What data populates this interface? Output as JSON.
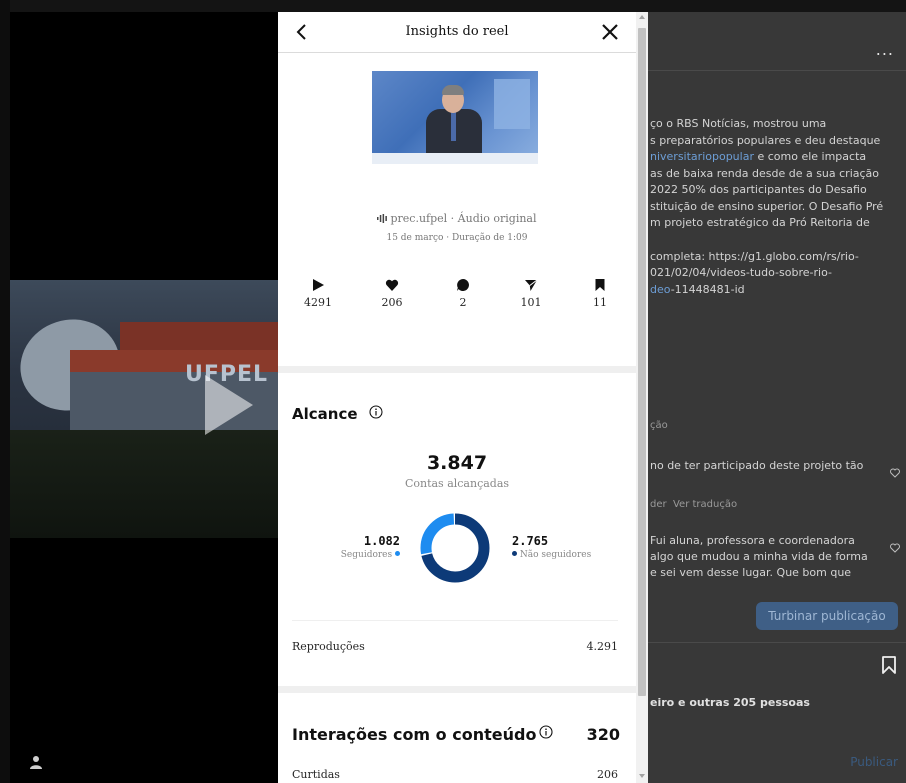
{
  "modal": {
    "title": "Insights do reel",
    "audio": "prec.ufpel · Áudio original",
    "date_duration": "15 de março · Duração de 1:09",
    "stats": [
      {
        "icon": "play-icon",
        "value": "4291"
      },
      {
        "icon": "heart-icon",
        "value": "206"
      },
      {
        "icon": "comment-icon",
        "value": "2"
      },
      {
        "icon": "share-icon",
        "value": "101"
      },
      {
        "icon": "bookmark-icon",
        "value": "11"
      }
    ],
    "reach": {
      "title": "Alcance",
      "total": "3.847",
      "total_label": "Contas alcançadas",
      "followers": {
        "value": "1.082",
        "label": "Seguidores",
        "color": "#1e8cf0",
        "fraction": 0.28
      },
      "non_followers": {
        "value": "2.765",
        "label": "Não seguidores",
        "color": "#0d3a78",
        "fraction": 0.72
      }
    },
    "rows": [
      {
        "label": "Reproduções",
        "value": "4.291"
      }
    ],
    "interactions": {
      "title": "Interações com o conteúdo",
      "total": "320",
      "rows": [
        {
          "label": "Curtidas",
          "value": "206"
        }
      ]
    }
  },
  "post": {
    "more": "...",
    "caption_lines": [
      "ço o RBS Notícias, mostrou uma",
      "s preparatórios populares e deu destaque"
    ],
    "caption_tag": "niversitariopopular",
    "caption_tag_rest": " e como ele impacta",
    "caption_lines2": [
      "as de baixa renda desde de a sua criação",
      "2022 50% dos participantes do Desafio",
      "stituição de ensino superior. O Desafio Pré",
      "m projeto estratégico da Pró Reitoria de"
    ],
    "link_lines": [
      "completa: https://g1.globo.com/rs/rio-",
      "021/02/04/videos-tudo-sobre-rio-"
    ],
    "link_tag": "deo",
    "link_rest": "-11448481-id",
    "meta1": "ção",
    "comment1": "no de ter participado deste projeto tão",
    "meta2_a": "der",
    "meta2_b": "Ver tradução",
    "comment2_lines": [
      "Fui aluna, professora e coordenadora",
      "algo que mudou a minha vida de forma",
      "e sei vem desse lugar. Que bom que"
    ],
    "boost": "Turbinar publicação",
    "likes": "eiro e outras 205 pessoas",
    "publish": "Publicar"
  }
}
